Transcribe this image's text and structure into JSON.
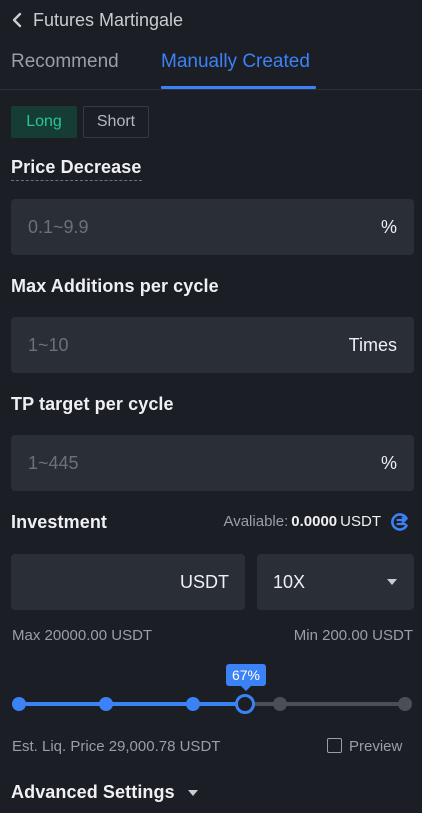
{
  "header": {
    "title": "Futures Martingale",
    "back_icon": "chevron-left-icon"
  },
  "tabs": [
    {
      "label": "Recommend",
      "active": false
    },
    {
      "label": "Manually Created",
      "active": true
    }
  ],
  "direction": {
    "long": "Long",
    "short": "Short",
    "selected": "Long"
  },
  "price_decrease": {
    "label": "Price Decrease",
    "placeholder": "0.1~9.9",
    "unit": "%"
  },
  "max_additions": {
    "label": "Max Additions per cycle",
    "placeholder": "1~10",
    "unit": "Times"
  },
  "tp_target": {
    "label": "TP target per cycle",
    "placeholder": "1~445",
    "unit": "%"
  },
  "investment": {
    "label": "Investment",
    "available_label": "Avaliable:",
    "available_value": "0.0000",
    "available_unit": "USDT",
    "swap_icon": "transfer-icon",
    "input_unit": "USDT",
    "leverage": "10X",
    "max_text": "Max 20000.00 USDT",
    "min_text": "Min 200.00 USDT"
  },
  "slider": {
    "percent_label": "67%",
    "value_percent": 67,
    "steps": 5
  },
  "liq_price": "Est. Liq. Price 29,000.78 USDT",
  "preview": {
    "label": "Preview",
    "checked": false
  },
  "advanced": {
    "label": "Advanced Settings"
  },
  "colors": {
    "accent": "#3b82f6",
    "long_green": "#26c59a",
    "bg": "#1b1e24",
    "field": "#2a2e36"
  }
}
